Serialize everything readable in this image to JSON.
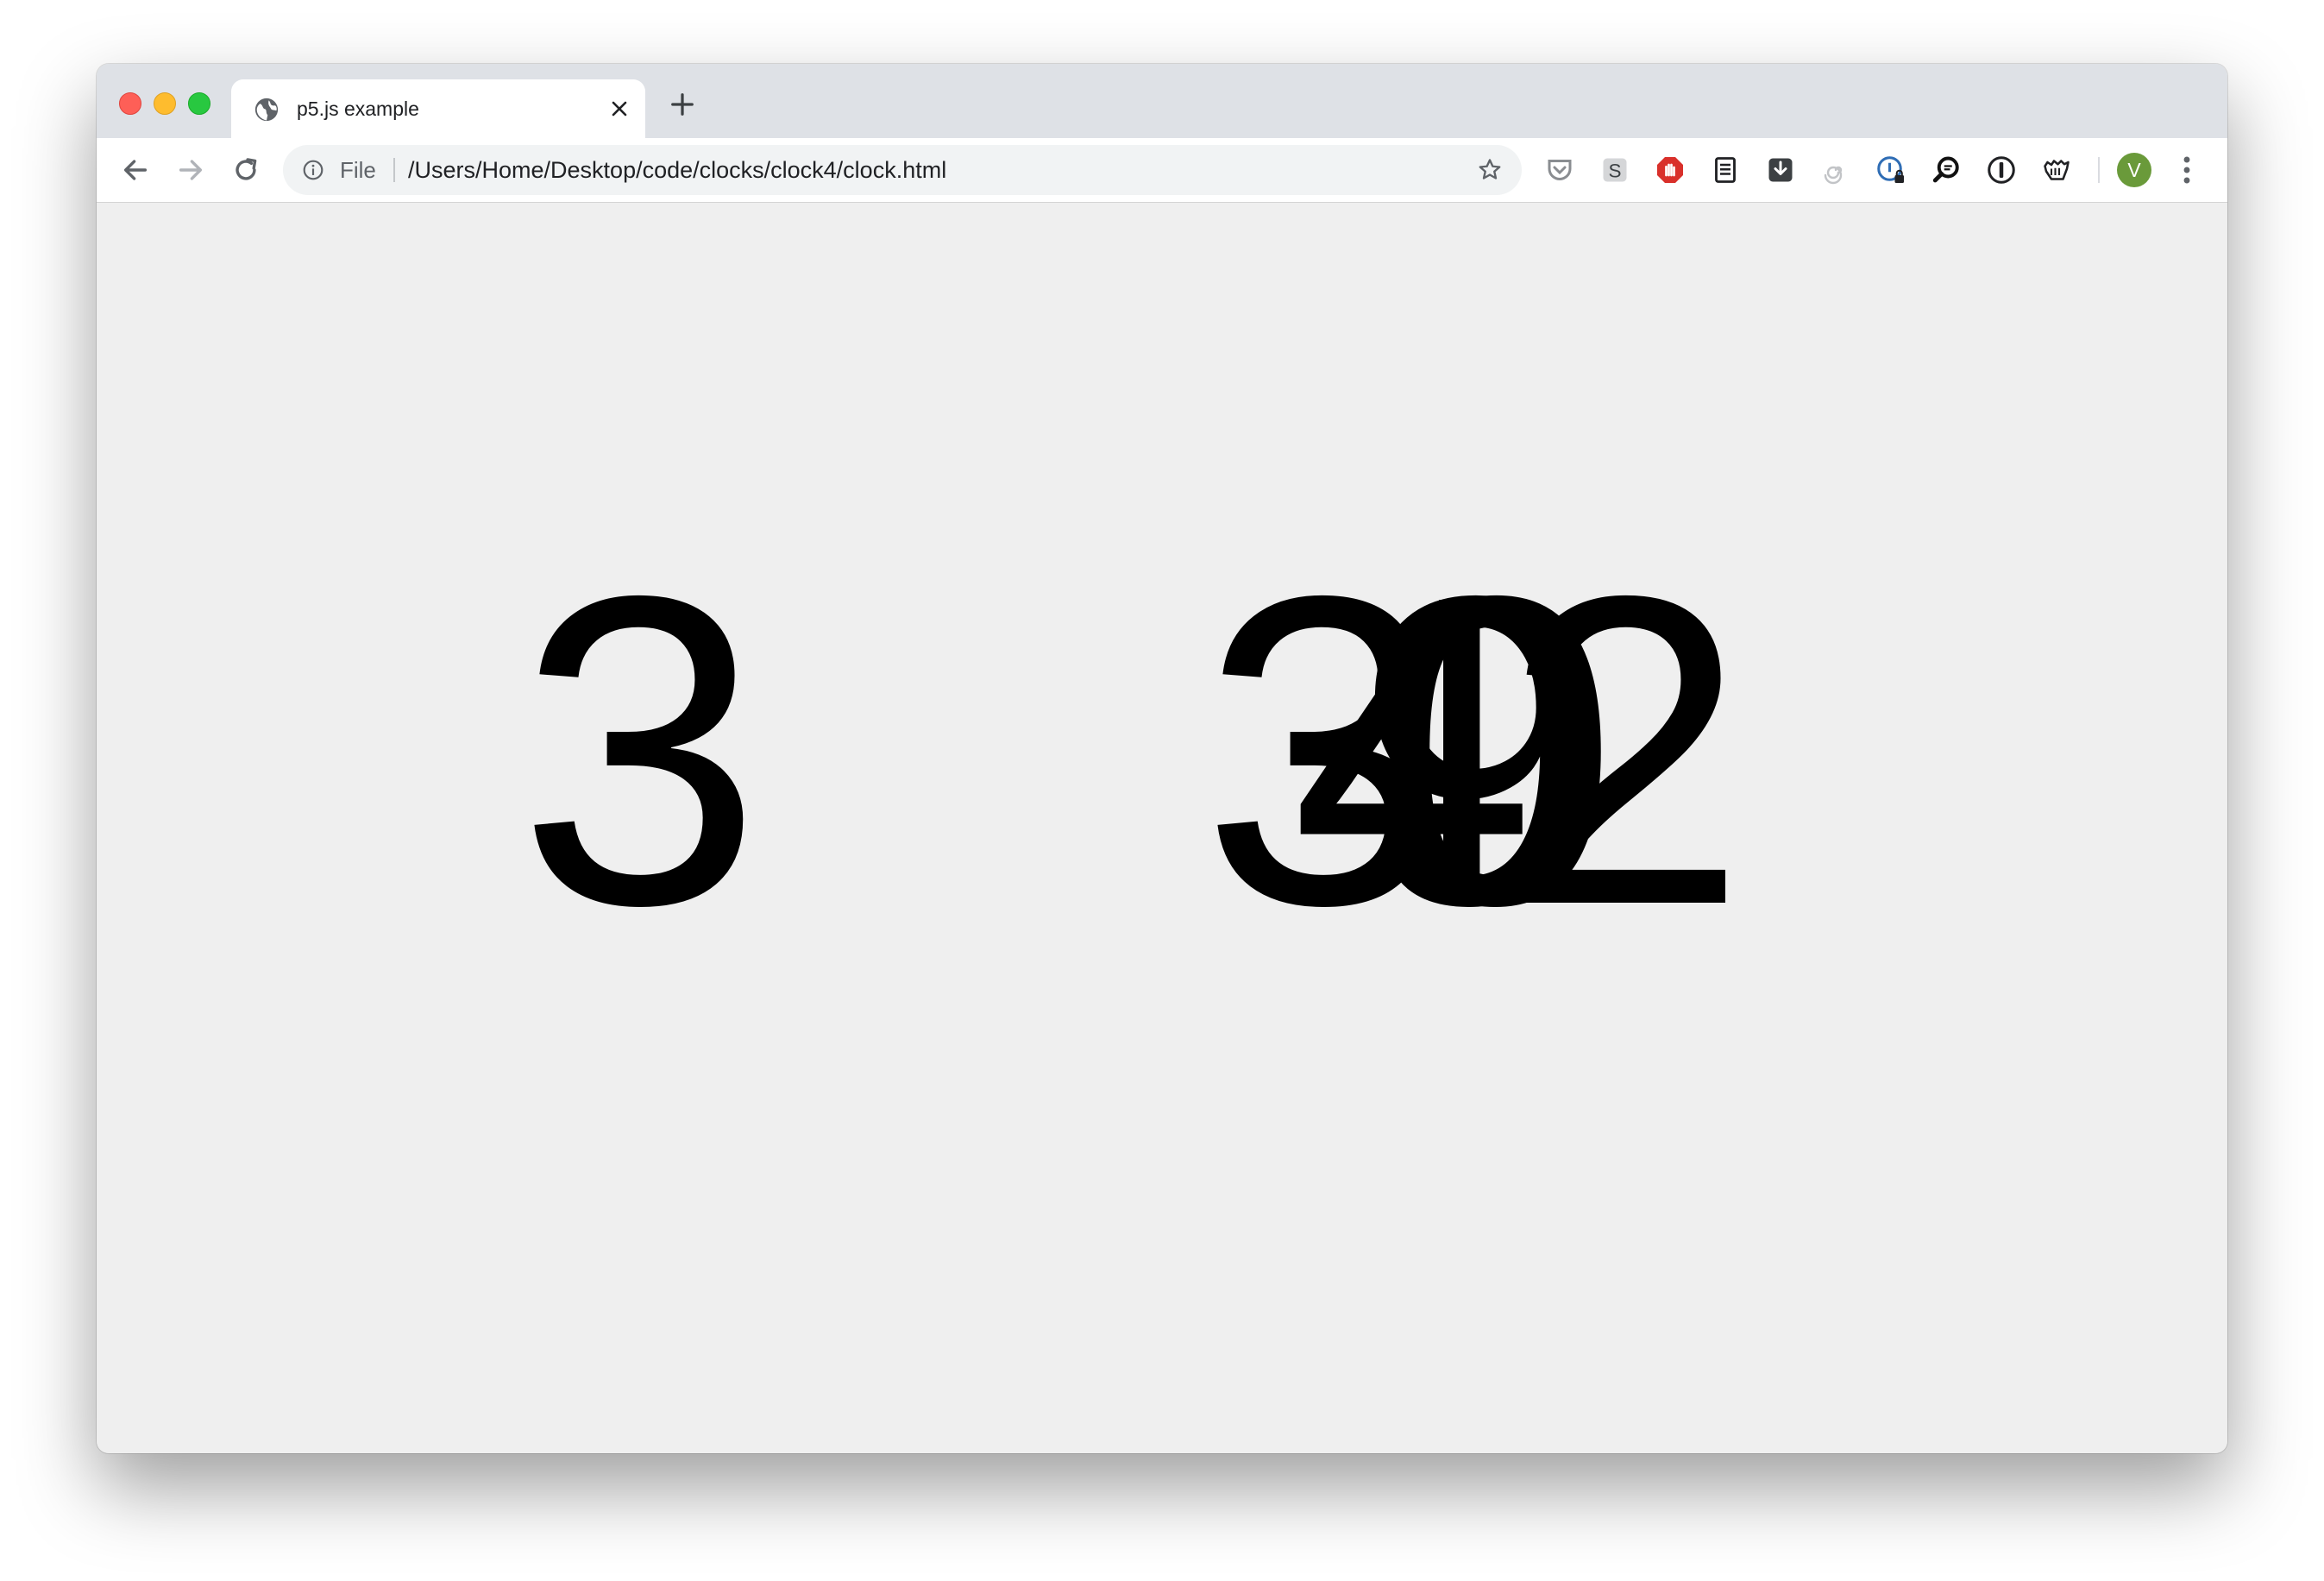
{
  "tab": {
    "title": "p5.js example"
  },
  "toolbar": {
    "scheme_label": "File",
    "url": "/Users/Home/Desktop/code/clocks/clock4/clock.html",
    "avatar_letter": "V"
  },
  "extensions": [
    "pocket-icon",
    "s-extension-icon",
    "adblock-icon",
    "reader-icon",
    "download-icon",
    "spiral-icon",
    "password-lock-icon",
    "search-chat-icon",
    "info-circle-icon",
    "glove-icon"
  ],
  "clock": {
    "left_digit": "3",
    "overlap_digits": [
      "3",
      "4",
      "0",
      "9",
      "2"
    ]
  }
}
